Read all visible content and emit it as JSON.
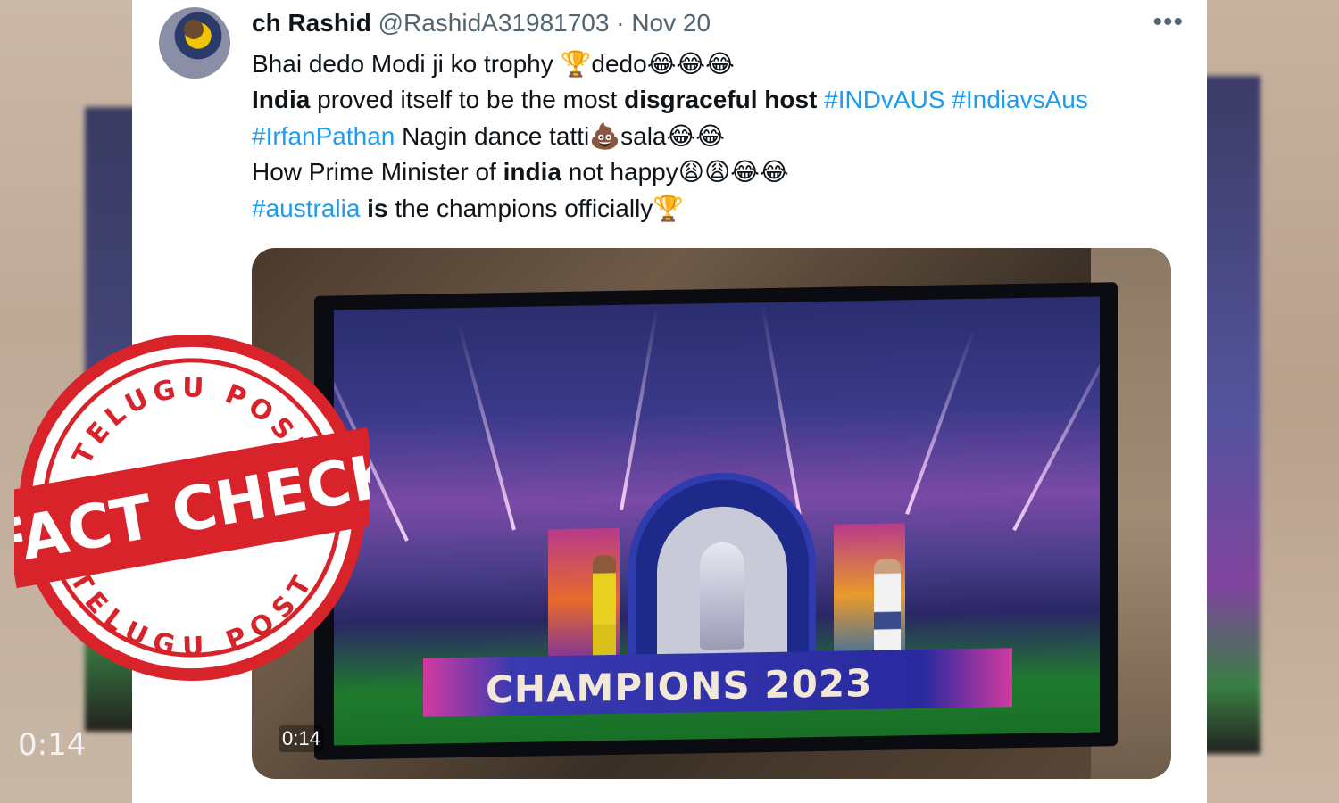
{
  "tweet": {
    "author_name": "ch Rashid",
    "author_handle": "@RashidA31981703",
    "separator": "·",
    "date": "Nov 20",
    "more_icon": "more-horizontal-icon",
    "lines": {
      "l1_text": "Bhai dedo Modi ji ko trophy ",
      "l1_emoji": "🏆",
      "l1_text2": "dedo",
      "l1_emoji2": "😂😂😂",
      "l2_bold1": "India",
      "l2_text": " proved itself to be the most ",
      "l2_bold2": "disgraceful host",
      "l2_tag1": " #INDvAUS",
      "l2_tag2": " #IndiavsAus",
      "l3_tag": "#IrfanPathan",
      "l3_text": " Nagin dance tatti",
      "l3_emoji": "💩",
      "l3_text2": "sala",
      "l3_emoji2": "😂😂",
      "l4_text": "How Prime Minister of ",
      "l4_bold": "india",
      "l4_text2": " not happy",
      "l4_emoji": "😩😩😂😂",
      "l5_tag": "#australia",
      "l5_bold": " is",
      "l5_text": " the champions officially",
      "l5_emoji": "🏆"
    }
  },
  "media": {
    "banner_text": "CHAMPIONS 2023",
    "duration": "0:14"
  },
  "background": {
    "left_duration": "0:14"
  },
  "stamp": {
    "top_text": "TELUGU POST",
    "bottom_text": "TELUGU POST",
    "main_text": "FACT CHECK",
    "color": "#d8232a"
  }
}
